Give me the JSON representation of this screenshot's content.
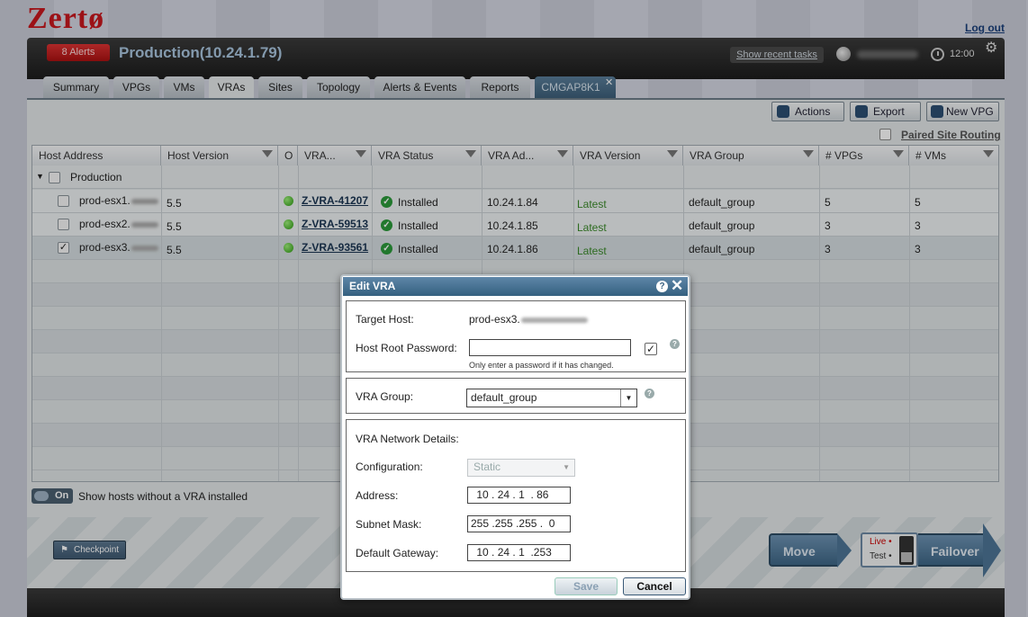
{
  "app": {
    "logo": "Zertø",
    "logout": "Log out"
  },
  "header": {
    "alerts": "8 Alerts",
    "site": "Production(10.24.1.79)",
    "recent_tasks": "Show recent tasks",
    "time": "12:00"
  },
  "tabs": [
    {
      "label": "Summary"
    },
    {
      "label": "VPGs"
    },
    {
      "label": "VMs"
    },
    {
      "label": "VRAs"
    },
    {
      "label": "Sites"
    },
    {
      "label": "Topology"
    },
    {
      "label": "Alerts & Events"
    },
    {
      "label": "Reports"
    },
    {
      "label": "CMGAP8K1"
    }
  ],
  "toolbar": {
    "actions": "Actions",
    "export": "Export",
    "new_vpg": "New VPG",
    "paired": "Paired Site Routing"
  },
  "grid": {
    "columns": [
      "Host Address",
      "Host Version",
      "O",
      "VRA...",
      "VRA Status",
      "VRA Ad...",
      "VRA Version",
      "VRA Group",
      "# VPGs",
      "# VMs"
    ],
    "group": "Production",
    "rows": [
      {
        "host": "prod-esx1.",
        "ver": "5.5",
        "vra": "Z-VRA-41207",
        "status": "Installed",
        "addr": "10.24.1.84",
        "vraver": "Latest",
        "group": "default_group",
        "vpgs": "5",
        "vms": "5",
        "checked": ""
      },
      {
        "host": "prod-esx2.",
        "ver": "5.5",
        "vra": "Z-VRA-59513",
        "status": "Installed",
        "addr": "10.24.1.85",
        "vraver": "Latest",
        "group": "default_group",
        "vpgs": "3",
        "vms": "3",
        "checked": ""
      },
      {
        "host": "prod-esx3.",
        "ver": "5.5",
        "vra": "Z-VRA-93561",
        "status": "Installed",
        "addr": "10.24.1.86",
        "vraver": "Latest",
        "group": "default_group",
        "vpgs": "3",
        "vms": "3",
        "checked": "✓"
      }
    ]
  },
  "bottom": {
    "toggle": "On",
    "toggle_label": "Show hosts without a VRA installed",
    "checkpoint": "Checkpoint",
    "move": "Move",
    "live": "Live",
    "test": "Test",
    "failover": "Failover"
  },
  "dialog": {
    "title": "Edit VRA",
    "target_host_label": "Target Host:",
    "target_host": "prod-esx3.",
    "password_label": "Host Root Password:",
    "password_value": "",
    "password_hint": "Only enter a password if it has changed.",
    "group_label": "VRA Group:",
    "group_value": "default_group",
    "network_title": "VRA Network Details:",
    "config_label": "Configuration:",
    "config_value": "Static",
    "address_label": "Address:",
    "address": [
      "10",
      "24",
      "1",
      "86"
    ],
    "subnet_label": "Subnet Mask:",
    "subnet": [
      "255",
      "255",
      "255",
      "0"
    ],
    "gateway_label": "Default Gateway:",
    "gateway": [
      "10",
      "24",
      "1",
      "253"
    ],
    "save": "Save",
    "cancel": "Cancel"
  }
}
